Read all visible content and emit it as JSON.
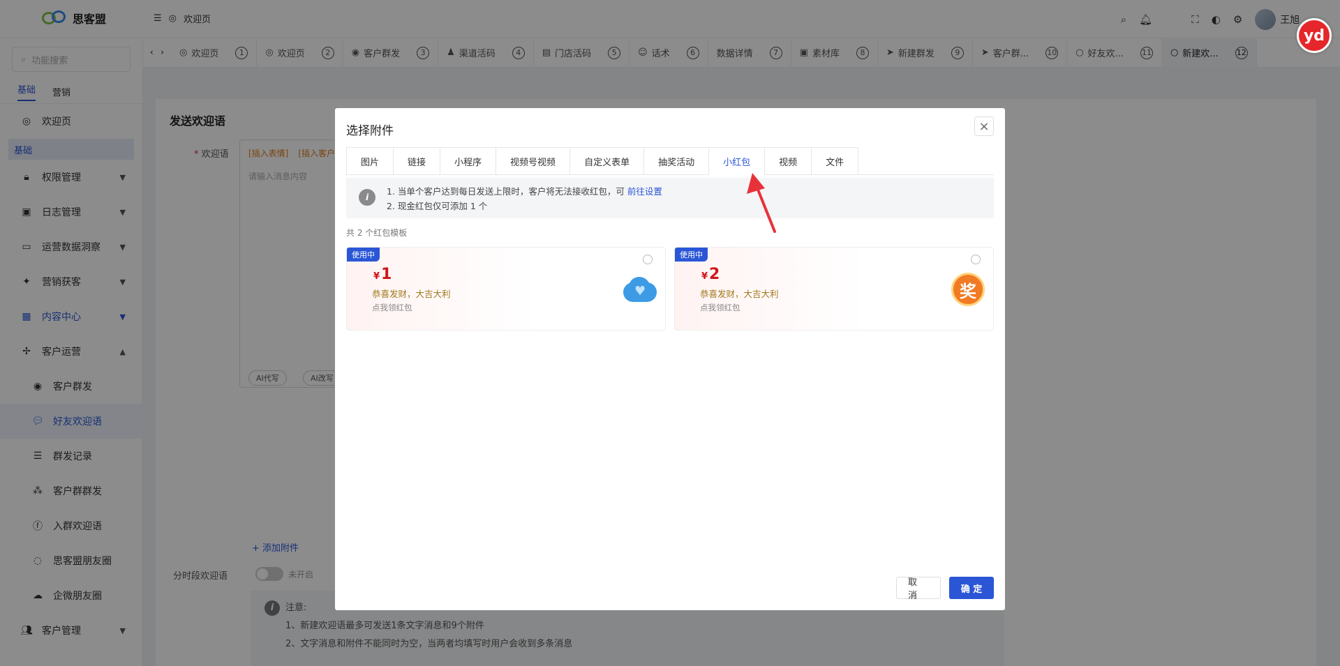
{
  "app": {
    "name": "思客盟",
    "welcome": "欢迎页",
    "user": "王旭",
    "badge": "yd"
  },
  "sidebar": {
    "search_placeholder": "功能搜索",
    "tabs": [
      "基础",
      "营销"
    ],
    "items": [
      {
        "label": "欢迎页"
      },
      {
        "label": "基础"
      },
      {
        "label": "权限管理"
      },
      {
        "label": "日志管理"
      },
      {
        "label": "运营数据洞察"
      },
      {
        "label": "营销获客"
      },
      {
        "label": "内容中心"
      },
      {
        "label": "客户运营"
      },
      {
        "label": "客户群发"
      },
      {
        "label": "好友欢迎语"
      },
      {
        "label": "群发记录"
      },
      {
        "label": "客户群群发"
      },
      {
        "label": "入群欢迎语"
      },
      {
        "label": "思客盟朋友圈"
      },
      {
        "label": "企微朋友圈"
      },
      {
        "label": "客户管理"
      }
    ]
  },
  "tabs": [
    {
      "label": "欢迎页",
      "num": "1"
    },
    {
      "label": "欢迎页",
      "num": "2"
    },
    {
      "label": "客户群发",
      "num": "3"
    },
    {
      "label": "渠道活码",
      "num": "4"
    },
    {
      "label": "门店活码",
      "num": "5"
    },
    {
      "label": "话术",
      "num": "6"
    },
    {
      "label": "数据详情",
      "num": "7"
    },
    {
      "label": "素材库",
      "num": "8"
    },
    {
      "label": "新建群发",
      "num": "9"
    },
    {
      "label": "客户群...",
      "num": "10"
    },
    {
      "label": "好友欢...",
      "num": "11"
    },
    {
      "label": "新建欢...",
      "num": "12"
    }
  ],
  "form": {
    "section_title": "发送欢迎语",
    "welcome_label": "欢迎语",
    "insert_emoji": "[插入表情]",
    "insert_customer": "[插入客户",
    "placeholder": "请输入消息内容",
    "ai_write": "AI代写",
    "ai_rewrite": "AI改写",
    "add_attachment": "+ 添加附件",
    "timed_label": "分时段欢迎语",
    "timed_status": "未开启",
    "notice_title": "注意:",
    "notice_lines": [
      "1、新建欢迎语最多可发送1条文字消息和9个附件",
      "2、文字消息和附件不能同时为空，当两者均填写时用户会收到多条消息"
    ]
  },
  "modal": {
    "title": "选择附件",
    "tabs": [
      "图片",
      "链接",
      "小程序",
      "视频号视频",
      "自定义表单",
      "抽奖活动",
      "小红包",
      "视频",
      "文件"
    ],
    "active_tab": "小红包",
    "notes": {
      "line1": "1. 当单个客户达到每日发送上限时，客户将无法接收红包，可",
      "link": "前往设置",
      "line2": "2. 现金红包仅可添加 1 个"
    },
    "count": "共 2 个红包模板",
    "cards": [
      {
        "badge": "使用中",
        "currency": "¥",
        "amount": "1",
        "blessing": "恭喜发财，大吉大利",
        "sub": "点我领红包",
        "icon": "cloud-heart-icon"
      },
      {
        "badge": "使用中",
        "currency": "¥",
        "amount": "2",
        "blessing": "恭喜发财，大吉大利",
        "sub": "点我领红包",
        "icon": "prize-icon",
        "icon_char": "奖"
      }
    ],
    "cancel": "取 消",
    "ok": "确 定"
  },
  "colors": {
    "primary": "#2a56d6",
    "danger": "#e5262a",
    "amount": "#d0141b"
  }
}
